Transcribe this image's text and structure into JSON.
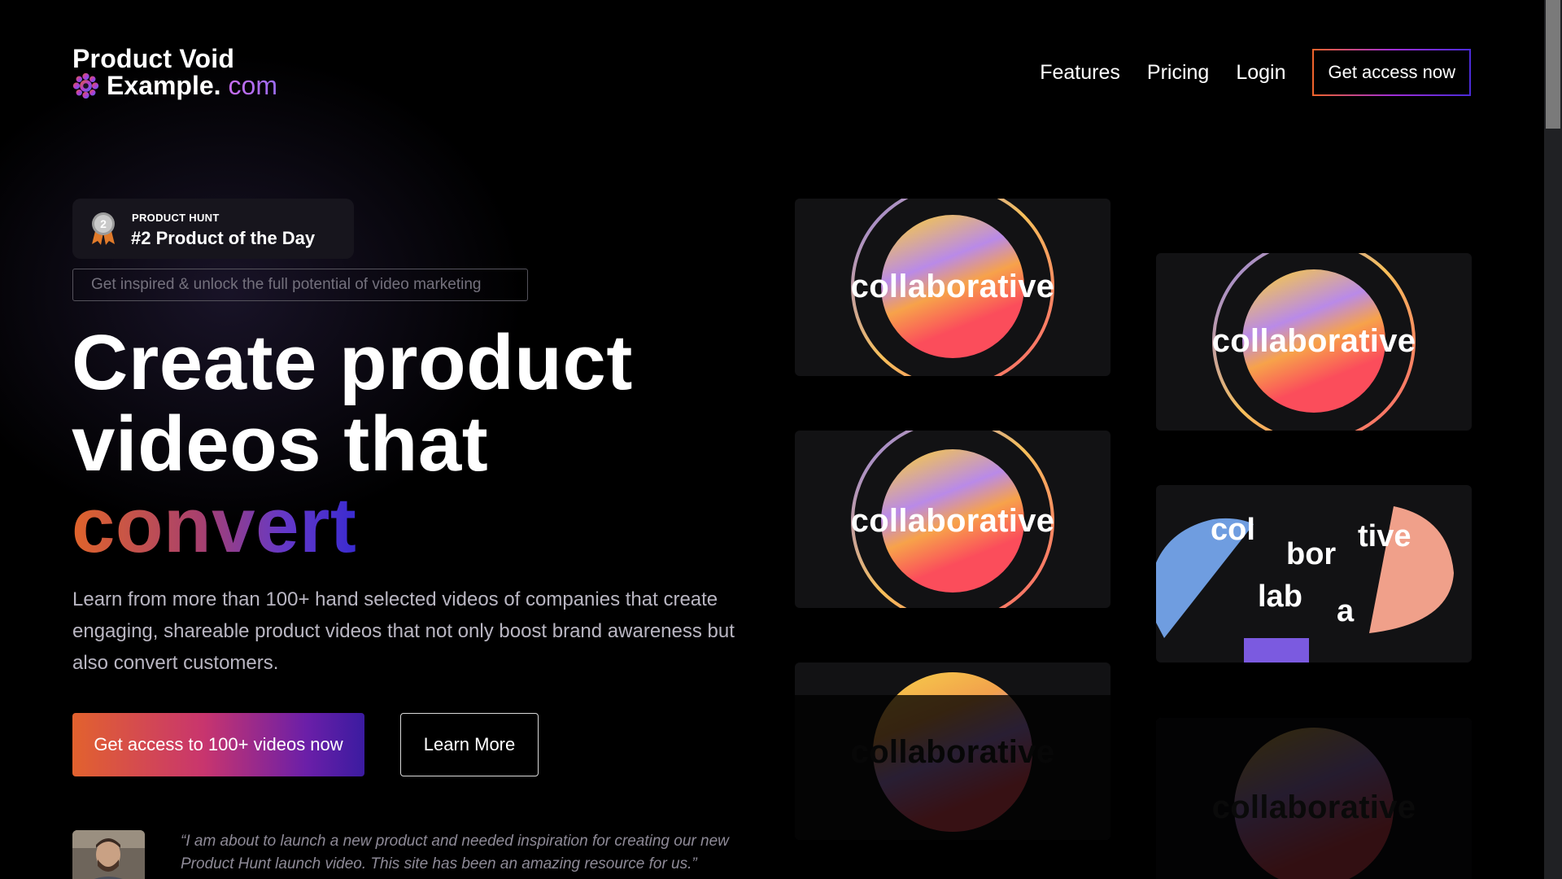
{
  "header": {
    "logo_line1": "Product Void",
    "logo_line2_main": "Example.",
    "logo_line2_suffix": "com",
    "logo_icon": "gear-flower-icon",
    "nav": [
      {
        "label": "Features"
      },
      {
        "label": "Pricing"
      },
      {
        "label": "Login"
      }
    ],
    "cta_label": "Get access now"
  },
  "badge": {
    "kicker": "PRODUCT HUNT",
    "title": "#2 Product of the Day",
    "medal_number": "2",
    "medal_icon": "award-medal-icon"
  },
  "hero": {
    "tagline": "Get inspired & unlock the full potential of video marketing",
    "headline_line1": "Create product",
    "headline_line2": "videos that",
    "headline_accent": "convert",
    "lead": "Learn from more than 100+ hand selected videos of companies that create engaging, shareable product videos that not only boost brand awareness but also convert customers.",
    "primary_button": "Get access to 100+ videos now",
    "secondary_button": "Learn More"
  },
  "testimonial": {
    "quote": "“I am about to launch a new product and needed inspiration for creating our new Product Hunt launch video. This site has been an amazing resource for us.”"
  },
  "tiles": {
    "word": "collaborative",
    "fragments": [
      "col",
      "bor",
      "tive",
      "lab",
      "a"
    ]
  },
  "colors": {
    "background": "#000000",
    "accent_orange": "#e2622e",
    "accent_purple": "#6b1fa8",
    "accent_indigo": "#3b1ba0",
    "tile_background": "#121214"
  }
}
